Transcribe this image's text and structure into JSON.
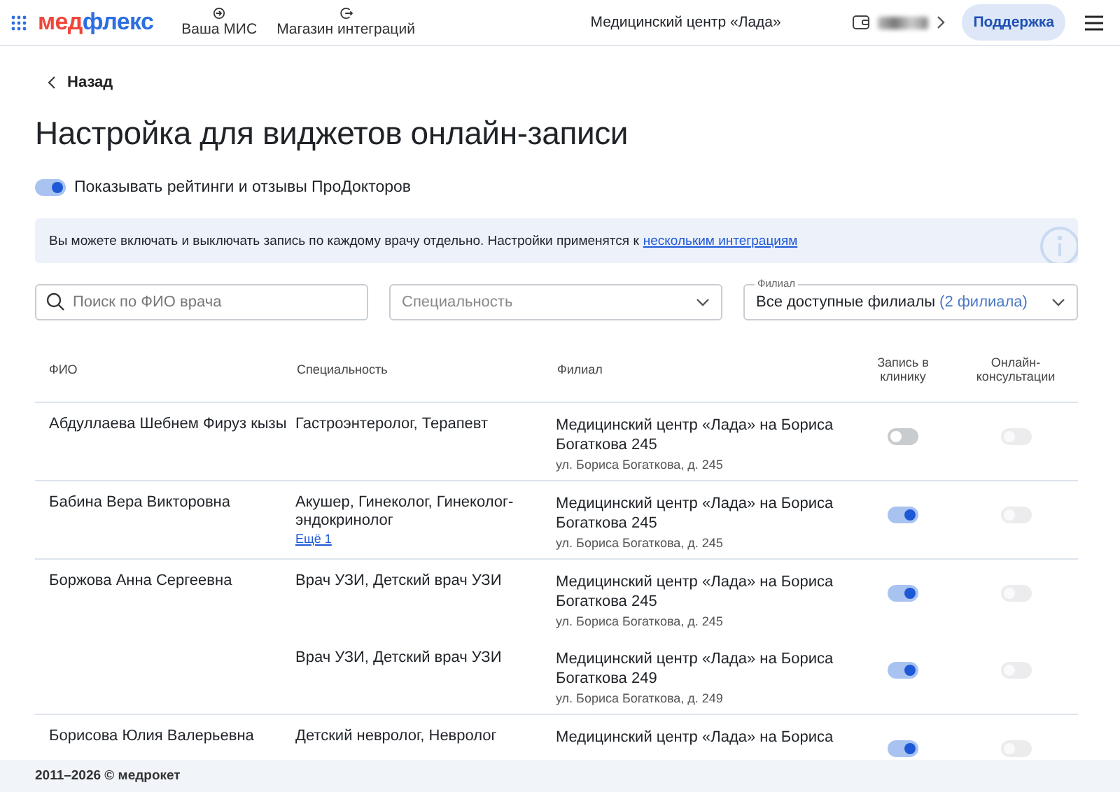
{
  "header": {
    "logo": {
      "part_1": "мед",
      "part_2": "флекс"
    },
    "nav": [
      {
        "label": "Ваша МИС",
        "kind": "enter"
      },
      {
        "label": "Магазин интеграций",
        "kind": "exit"
      }
    ],
    "clinic": "Медицинский центр «Лада»",
    "support_button": "Поддержка"
  },
  "back": "Назад",
  "title": "Настройка для виджетов онлайн-записи",
  "ratings_toggle": {
    "label": "Показывать рейтинги и отзывы ПроДокторов",
    "on": true
  },
  "info": {
    "text": "Вы можете включать и выключать запись по каждому врачу отдельно. Настройки применятся к",
    "link": "нескольким интеграциям"
  },
  "filters": {
    "search": {
      "placeholder": "Поиск по ФИО врача"
    },
    "specialty": {
      "placeholder": "Специальность"
    },
    "branch": {
      "label": "Филиал",
      "value": "Все доступные филиалы",
      "count": "(2 филиала)"
    }
  },
  "table": {
    "columns": [
      "ФИО",
      "Специальность",
      "Филиал",
      "Запись в клинику",
      "Онлайн-консультации"
    ],
    "rows": [
      {
        "name": "Абдуллаева Шебнем Фируз кызы",
        "branches": [
          {
            "specialty": "Гастроэнтеролог, Терапевт",
            "branch": "Медицинский центр «Лада» на Бориса Богаткова 245",
            "address": "ул. Бориса Богаткова, д. 245",
            "clinic_booking": false,
            "online": false
          }
        ]
      },
      {
        "name": "Бабина Вера Викторовна",
        "branches": [
          {
            "specialty": "Акушер, Гинеколог, Гинеколог-эндокринолог",
            "more": "Ещё 1",
            "branch": "Медицинский центр «Лада» на Бориса Богаткова 245",
            "address": "ул. Бориса Богаткова, д. 245",
            "clinic_booking": true,
            "online": false
          }
        ]
      },
      {
        "name": "Боржова Анна Сергеевна",
        "branches": [
          {
            "specialty": "Врач УЗИ, Детский врач УЗИ",
            "branch": "Медицинский центр «Лада» на Бориса Богаткова 245",
            "address": "ул. Бориса Богаткова, д. 245",
            "clinic_booking": true,
            "online": false
          },
          {
            "specialty": "Врач УЗИ, Детский врач УЗИ",
            "branch": "Медицинский центр «Лада» на Бориса Богаткова 249",
            "address": "ул. Бориса Богаткова, д. 249",
            "clinic_booking": true,
            "online": false
          }
        ]
      },
      {
        "name": "Борисова Юлия Валерьевна",
        "branches": [
          {
            "specialty": "Детский невролог, Невролог",
            "branch": "Медицинский центр «Лада» на Бориса",
            "clinic_booking": true,
            "online": false
          }
        ]
      }
    ]
  },
  "footer": "2011–2026 © медрокет"
}
